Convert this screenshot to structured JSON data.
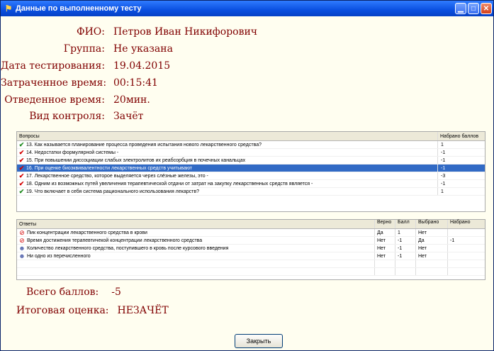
{
  "window": {
    "title": "Данные по выполненному тесту"
  },
  "info": [
    {
      "label": "ФИО:",
      "value": "Петров Иван Никифорович"
    },
    {
      "label": "Группа:",
      "value": "Не указана"
    },
    {
      "label": "Дата тестирования:",
      "value": "19.04.2015"
    },
    {
      "label": "Затраченное время:",
      "value": "00:15:41"
    },
    {
      "label": "Отведенное время:",
      "value": "20мин."
    },
    {
      "label": "Вид контроля:",
      "value": "Зачёт"
    }
  ],
  "questions": {
    "headers": [
      "Вопросы",
      "Набрано баллов"
    ],
    "rows": [
      {
        "mark": "ok",
        "text": "13. Как называется планирование процесса проведения испытания нового лекарственного средства?",
        "score": "1"
      },
      {
        "mark": "bad",
        "text": "14. Недостатки формулярной системы -",
        "score": "-1"
      },
      {
        "mark": "bad",
        "text": "15. При повышении диссоциации слабых электролитов их реабсорбция в почечных канальцах",
        "score": "-1"
      },
      {
        "mark": "bad",
        "text": "16. При оценке биоэквивалентности лекарственных средств учитывают",
        "score": "-1",
        "selected": true
      },
      {
        "mark": "bad",
        "text": "17. Лекарственное средство, которое выделяется через слёзные железы, это -",
        "score": "-3"
      },
      {
        "mark": "bad",
        "text": "18. Одним из возможных путей увеличения терапевтической отдачи от затрат на закупку лекарственных средств является -",
        "score": "-1"
      },
      {
        "mark": "ok",
        "text": "19. Что включает в себя система рационального использования лекарств?",
        "score": "1"
      }
    ]
  },
  "answers": {
    "headers": [
      "Ответы",
      "Верно",
      "Балл",
      "Выбрано",
      "Набрано"
    ],
    "rows": [
      {
        "icon": "no",
        "text": "Пик концентрации лекарственного средства в крови",
        "correct": "Да",
        "points": "1",
        "chosen": "Нет",
        "got": ""
      },
      {
        "icon": "no",
        "text": "Время достижения терапевтичекой концентрации лекарственного средства",
        "correct": "Нет",
        "points": "-1",
        "chosen": "Да",
        "got": "-1"
      },
      {
        "icon": "grp",
        "text": "Количество лекарственного средства, поступившего в кровь после курсового введения",
        "correct": "Нет",
        "points": "-1",
        "chosen": "Нет",
        "got": ""
      },
      {
        "icon": "grp",
        "text": "Ни одно из перечисленного",
        "correct": "Нет",
        "points": "-1",
        "chosen": "Нет",
        "got": ""
      }
    ]
  },
  "summary": [
    {
      "label": "Всего баллов:",
      "value": "-5"
    },
    {
      "label": "Итоговая оценка:",
      "value": "НЕЗАЧЁТ"
    }
  ],
  "close_button": "Закрыть"
}
